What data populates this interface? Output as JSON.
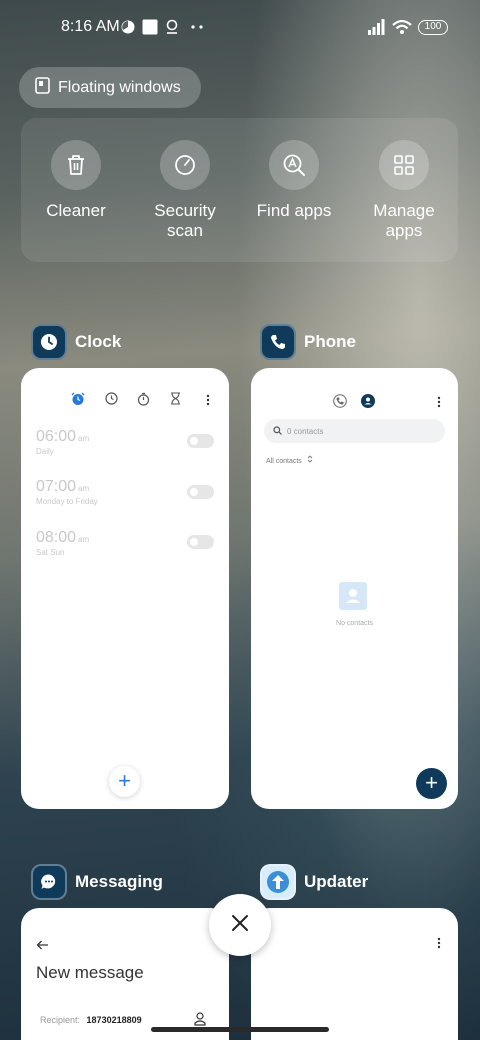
{
  "status_bar": {
    "time": "8:16 AM",
    "battery": "100",
    "icons": [
      "pie-chart-icon",
      "square-notification-icon",
      "location-pin-icon",
      "more-dots-icon",
      "signal-icon",
      "wifi-icon",
      "battery-icon"
    ]
  },
  "floating_windows": {
    "label": "Floating windows",
    "icon": "floating-window-icon"
  },
  "quick_actions": [
    {
      "label": "Cleaner",
      "icon": "trash-icon"
    },
    {
      "label": "Security scan",
      "icon": "security-scan-icon"
    },
    {
      "label": "Find apps",
      "icon": "find-apps-icon"
    },
    {
      "label": "Manage apps",
      "icon": "grid-apps-icon"
    }
  ],
  "recent_apps": [
    {
      "name": "Clock",
      "icon": "clock-icon",
      "tabs": [
        "alarm-icon",
        "world-clock-icon",
        "stopwatch-icon",
        "timer-icon"
      ],
      "alarms": [
        {
          "time": "06:00",
          "ampm": "am",
          "days": "Daily"
        },
        {
          "time": "07:00",
          "ampm": "am",
          "days": "Monday to Friday"
        },
        {
          "time": "08:00",
          "ampm": "am",
          "days": "Sat Sun"
        }
      ],
      "fab": "+"
    },
    {
      "name": "Phone",
      "icon": "phone-icon",
      "search_placeholder": "0 contacts",
      "filter_label": "All contacts",
      "empty_text": "No contacts",
      "fab": "+"
    },
    {
      "name": "Messaging",
      "icon": "messaging-icon",
      "title": "New message",
      "recipient_label": "Recipient:",
      "recipient_value": "18730218809"
    },
    {
      "name": "Updater",
      "icon": "updater-icon"
    }
  ],
  "colors": {
    "accent_blue": "#2979d8",
    "app_icon_bg": "#0f3a5a",
    "updater_blue": "#3b8fd6"
  }
}
